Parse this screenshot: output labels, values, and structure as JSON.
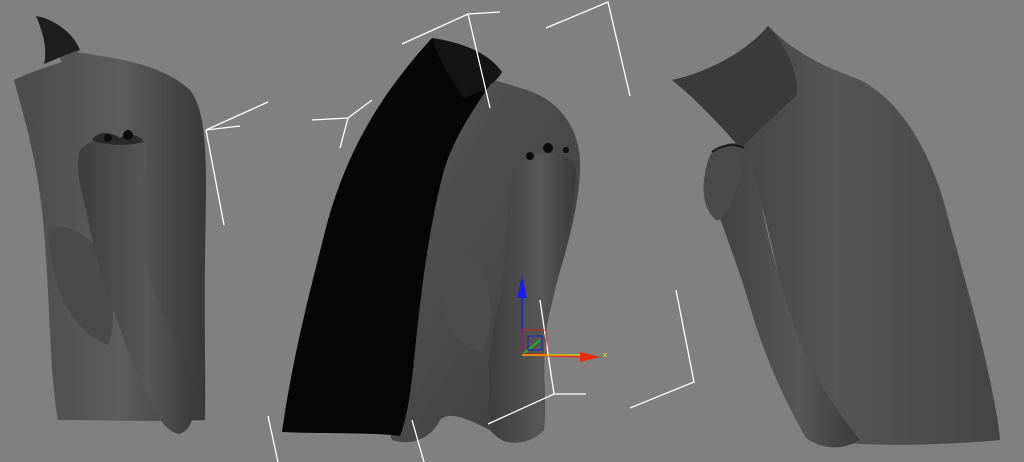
{
  "viewport": {
    "background": "#808080",
    "objects": [
      {
        "name": "torso-left-view",
        "kind": "mesh"
      },
      {
        "name": "torso-center-view",
        "kind": "mesh"
      },
      {
        "name": "torso-right-view",
        "kind": "mesh"
      }
    ],
    "gizmo": {
      "axis_x_label": "x",
      "x_color": "#e82a10",
      "y_color": "#18c810",
      "z_color": "#1c1cf0",
      "icon": "transform-gizmo-icon"
    },
    "bounding_box_color": "#ffffff",
    "cloth_color": "#050505"
  }
}
